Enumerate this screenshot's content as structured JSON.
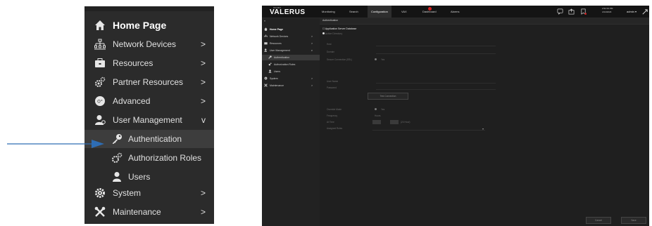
{
  "zoom_panel": {
    "items": [
      {
        "label": "Home Page"
      },
      {
        "label": "Network Devices",
        "chevron": ">"
      },
      {
        "label": "Resources",
        "chevron": ">"
      },
      {
        "label": "Partner Resources",
        "chevron": ">"
      },
      {
        "label": "Advanced",
        "chevron": ">"
      },
      {
        "label": "User Management",
        "chevron": "v"
      },
      {
        "label": "Authentication"
      },
      {
        "label": "Authorization Roles"
      },
      {
        "label": "Users"
      },
      {
        "label": "System",
        "chevron": ">"
      },
      {
        "label": "Maintenance",
        "chevron": ">"
      }
    ]
  },
  "arrow": {
    "color": "#2e6db4"
  },
  "app": {
    "brand_small": "VICON",
    "brand": "VALERUS",
    "nav": [
      "Monitoring",
      "Search",
      "Configuration",
      "VAX",
      "Dashboard",
      "Alarms"
    ],
    "active_nav": "Configuration",
    "clock_time": "2:52:33 PM",
    "clock_date": "4/14/2023",
    "user": "admin",
    "user_chevron": "▾",
    "collapse": "«",
    "sidebar": [
      {
        "label": "Home Page"
      },
      {
        "label": "Network Devices",
        "chevron": ">"
      },
      {
        "label": "Resources",
        "chevron": ">"
      },
      {
        "label": "User Management",
        "chevron": "v"
      },
      {
        "label": "Authentication"
      },
      {
        "label": "Authorization Roles"
      },
      {
        "label": "Users"
      },
      {
        "label": "System",
        "chevron": ">"
      },
      {
        "label": "Maintenance",
        "chevron": ">"
      }
    ],
    "content": {
      "header": "Authentication",
      "checkbox_label": "Application Server Database",
      "sub_option": "Active Directory",
      "fields": {
        "host": "Host",
        "domain": "Domain",
        "secure": "Secure Connection (SSL)",
        "secure_value": "Yes",
        "user_name": "User Name",
        "password": "Password",
        "test_button": "Test Connection",
        "override": "Override Mode",
        "override_value": "Yes",
        "frequency": "Frequency",
        "frequency_value": "Hours",
        "at": "At Time",
        "at_suffix": "(24 Hour)",
        "role": "Assigned Roles"
      },
      "buttons": {
        "cancel": "Cancel",
        "save": "Save"
      }
    }
  }
}
